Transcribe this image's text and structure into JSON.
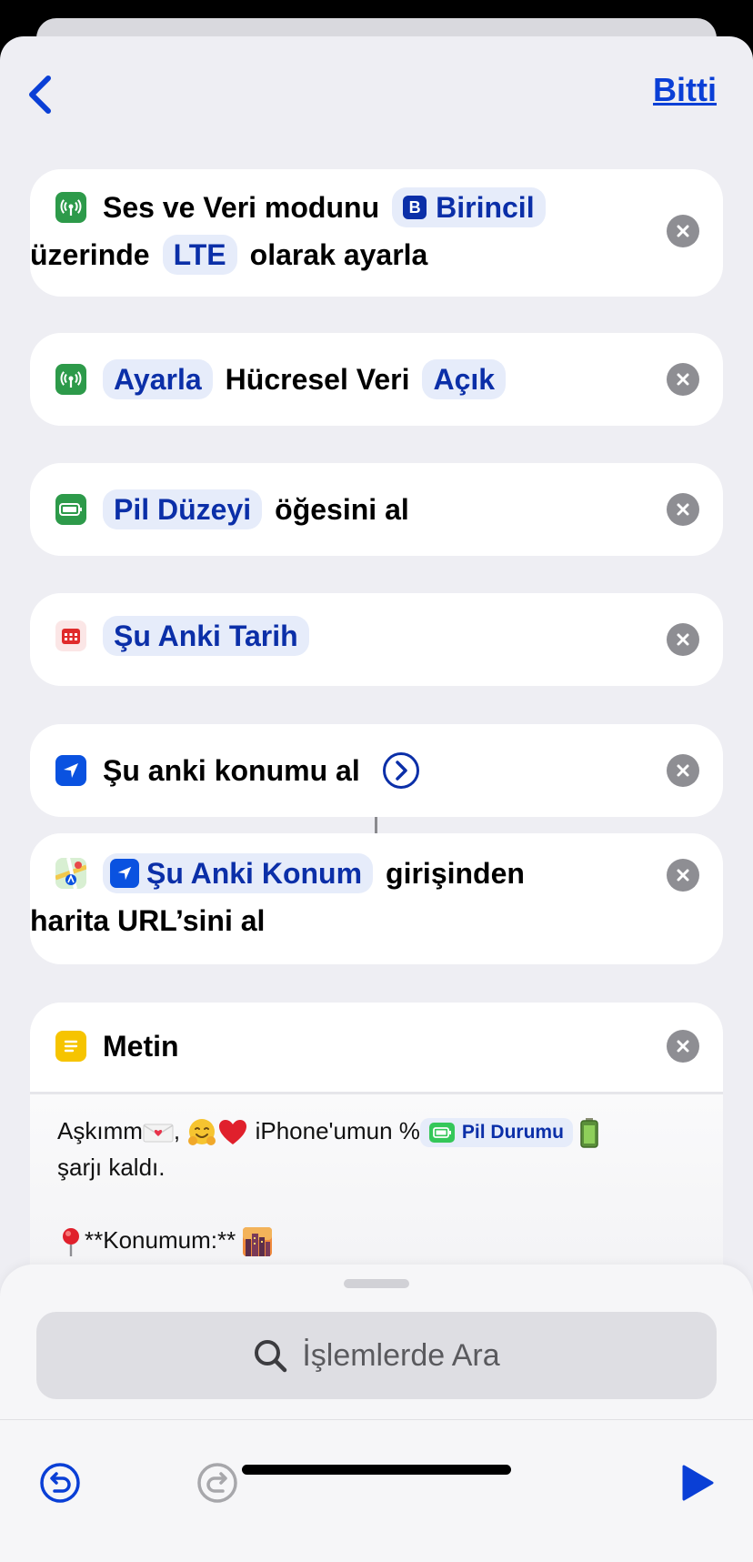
{
  "nav": {
    "done_label": "Bitti"
  },
  "colors": {
    "accent": "#0a3fd6",
    "pill_bg": "#e6ecfa",
    "cellular_green": "#2d9a4a",
    "notes_yellow": "#f6c400"
  },
  "actions": [
    {
      "icon": "antenna-icon",
      "parts": [
        "Ses ve Veri modunu",
        "Birincil",
        "üzerinde",
        "LTE",
        "olarak ayarla"
      ]
    },
    {
      "icon": "antenna-icon",
      "parts": [
        "Ayarla",
        "Hücresel Veri",
        "Açık"
      ]
    },
    {
      "icon": "battery-icon",
      "parts": [
        "Pil Düzeyi",
        "öğesini al"
      ]
    },
    {
      "icon": "calendar-icon",
      "parts": [
        "Şu Anki Tarih"
      ]
    },
    {
      "icon": "location-arrow-icon",
      "parts": [
        "Şu anki konumu al"
      ]
    },
    {
      "icon": "maps-icon",
      "parts": [
        "Şu Anki Konum",
        "girişinden",
        "harita URL’sini al"
      ]
    }
  ],
  "text_action": {
    "title": "Metin",
    "line1_a": "Aşkımm",
    "line1_b": ",",
    "line1_c": "iPhone'umun %",
    "pill": "Pil Durumu",
    "line2": "şarjı kaldı.",
    "line3": "**Konumum:**"
  },
  "search": {
    "placeholder": "İşlemlerde Ara"
  }
}
